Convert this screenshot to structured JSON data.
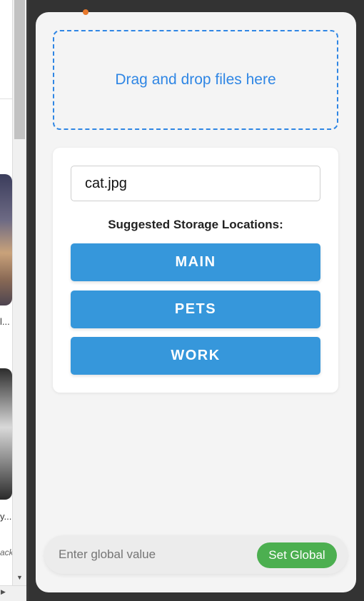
{
  "background_page": {
    "snippets": [
      "l...",
      "y...",
      "ack"
    ]
  },
  "panel": {
    "drop_zone": {
      "label": "Drag and drop files here"
    },
    "file_card": {
      "filename": "cat.jpg",
      "suggestions_title": "Suggested Storage Locations:",
      "locations": [
        {
          "label": "MAIN"
        },
        {
          "label": "PETS"
        },
        {
          "label": "WORK"
        }
      ]
    },
    "global": {
      "placeholder": "Enter global value",
      "button_label": "Set Global"
    }
  },
  "colors": {
    "accent_blue": "#3697db",
    "drop_zone_blue": "#2f86e4",
    "set_global_green": "#4caf50"
  }
}
